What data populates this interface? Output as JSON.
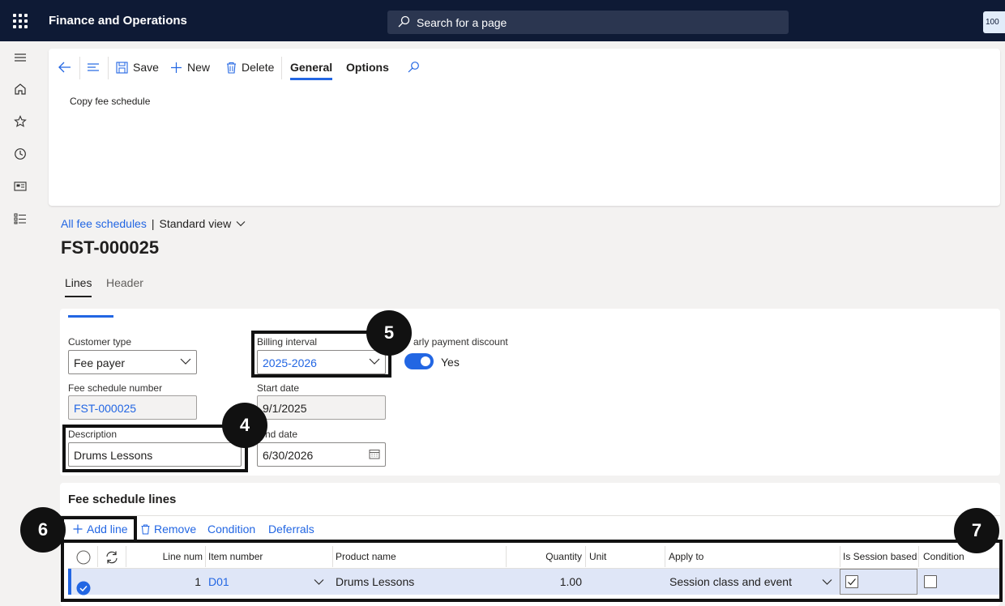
{
  "app": {
    "title": "Finance and Operations",
    "search_placeholder": "Search for a page",
    "user_badge": "100"
  },
  "toolbar": {
    "save": "Save",
    "new": "New",
    "delete": "Delete",
    "tab_general": "General",
    "tab_options": "Options"
  },
  "action_pane": {
    "copy_fee_schedule": "Copy fee schedule"
  },
  "breadcrumb": {
    "link": "All fee schedules",
    "separator": "|",
    "view": "Standard view"
  },
  "record": {
    "title": "FST-000025"
  },
  "subtabs": {
    "lines": "Lines",
    "header": "Header"
  },
  "form": {
    "customer_type_label": "Customer type",
    "customer_type_value": "Fee payer",
    "fee_schedule_number_label": "Fee schedule number",
    "fee_schedule_number_value": "FST-000025",
    "description_label": "Description",
    "description_value": "Drums Lessons",
    "billing_interval_label": "Billing interval",
    "billing_interval_value": "2025-2026",
    "start_date_label": "Start date",
    "start_date_value": "9/1/2025",
    "end_date_label": "nd date",
    "end_date_value": "6/30/2026",
    "early_payment_label": "arly payment discount",
    "early_payment_value": "Yes"
  },
  "callouts": {
    "c4": "4",
    "c5": "5",
    "c6": "6",
    "c7": "7"
  },
  "lines": {
    "title": "Fee schedule lines",
    "add_line": "Add line",
    "remove": "Remove",
    "condition": "Condition",
    "deferrals": "Deferrals",
    "columns": {
      "line_num": "Line num",
      "item_number": "Item number",
      "product_name": "Product name",
      "quantity": "Quantity",
      "unit": "Unit",
      "apply_to": "Apply to",
      "is_session_based": "Is Session based",
      "condition": "Condition"
    },
    "rows": [
      {
        "line_num": "1",
        "item_number": "D01",
        "product_name": "Drums Lessons",
        "quantity": "1.00",
        "unit": "",
        "apply_to": "Session class and event",
        "is_session_based": true,
        "condition": false
      }
    ]
  },
  "colors": {
    "accent": "#2266e3",
    "topbar": "#0e1a35",
    "selected_row": "#dfe6f7",
    "callout": "#111111"
  }
}
